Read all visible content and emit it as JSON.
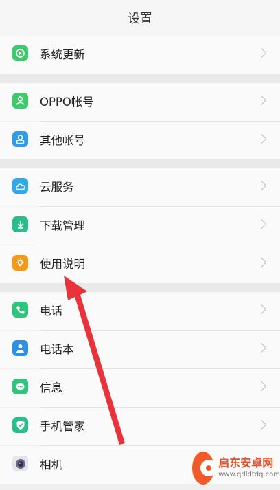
{
  "header": {
    "title": "设置"
  },
  "rows": [
    {
      "label": "系统更新",
      "icon": "update-icon",
      "color": "#3ec96b"
    },
    {
      "label": "OPPO帐号",
      "icon": "account-icon",
      "color": "#3ec96b"
    },
    {
      "label": "其他帐号",
      "icon": "user-icon",
      "color": "#2f9be9"
    },
    {
      "label": "云服务",
      "icon": "cloud-icon",
      "color": "#2fa9e8"
    },
    {
      "label": "下载管理",
      "icon": "download-icon",
      "color": "#2bbd8a"
    },
    {
      "label": "使用说明",
      "icon": "bulb-icon",
      "color": "#f39a1e"
    },
    {
      "label": "电话",
      "icon": "phone-icon",
      "color": "#2fc57d"
    },
    {
      "label": "电话本",
      "icon": "contacts-icon",
      "color": "#2f8fe4"
    },
    {
      "label": "信息",
      "icon": "message-icon",
      "color": "#2fc57d"
    },
    {
      "label": "手机管家",
      "icon": "shield-icon",
      "color": "#2bbd8a"
    },
    {
      "label": "相机",
      "icon": "camera-icon",
      "color": "#6a6a86"
    }
  ],
  "watermark": {
    "name": "启东安卓网",
    "url": "www.qdldtdq.com"
  },
  "colors": {
    "arrow": "#e8333a"
  }
}
